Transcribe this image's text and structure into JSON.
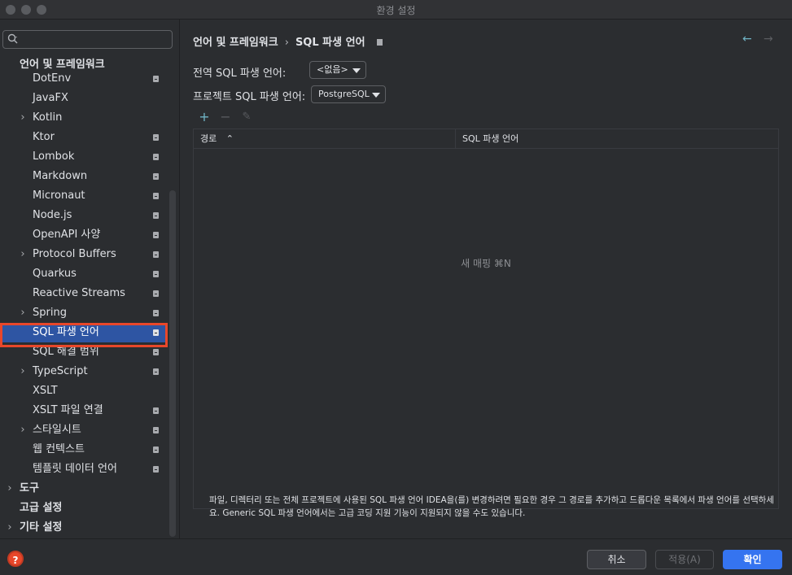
{
  "window": {
    "title": "환경 설정"
  },
  "sidebar": {
    "search_placeholder": "",
    "section_title": "언어 및 프레임워크",
    "items": [
      {
        "label": "DotEnv",
        "chevron": false,
        "mod": true
      },
      {
        "label": "JavaFX",
        "chevron": false,
        "mod": false
      },
      {
        "label": "Kotlin",
        "chevron": true,
        "mod": false
      },
      {
        "label": "Ktor",
        "chevron": false,
        "mod": true
      },
      {
        "label": "Lombok",
        "chevron": false,
        "mod": true
      },
      {
        "label": "Markdown",
        "chevron": false,
        "mod": true
      },
      {
        "label": "Micronaut",
        "chevron": false,
        "mod": true
      },
      {
        "label": "Node.js",
        "chevron": false,
        "mod": true
      },
      {
        "label": "OpenAPI 사양",
        "chevron": false,
        "mod": true
      },
      {
        "label": "Protocol Buffers",
        "chevron": true,
        "mod": true
      },
      {
        "label": "Quarkus",
        "chevron": false,
        "mod": true
      },
      {
        "label": "Reactive Streams",
        "chevron": false,
        "mod": true
      },
      {
        "label": "Spring",
        "chevron": true,
        "mod": true
      },
      {
        "label": "SQL 파생 언어",
        "chevron": false,
        "mod": true,
        "selected": true
      },
      {
        "label": "SQL 해결 범위",
        "chevron": false,
        "mod": true
      },
      {
        "label": "TypeScript",
        "chevron": true,
        "mod": true
      },
      {
        "label": "XSLT",
        "chevron": false,
        "mod": false
      },
      {
        "label": "XSLT 파일 연결",
        "chevron": false,
        "mod": true
      },
      {
        "label": "스타일시트",
        "chevron": true,
        "mod": true
      },
      {
        "label": "웹 컨텍스트",
        "chevron": false,
        "mod": true
      },
      {
        "label": "템플릿 데이터 언어",
        "chevron": false,
        "mod": true
      }
    ],
    "top_items": [
      {
        "label": "도구",
        "chevron": true
      },
      {
        "label": "고급 설정",
        "chevron": false
      },
      {
        "label": "기타 설정",
        "chevron": true
      }
    ]
  },
  "main": {
    "breadcrumb": {
      "parent": "언어 및 프레임워크",
      "separator": "›",
      "current": "SQL 파생 언어"
    },
    "nav": {
      "back": "←",
      "forward": "→"
    },
    "global_dialect_label": "전역 SQL 파생 언어:",
    "global_dialect_value": "<없음>",
    "project_dialect_label": "프로젝트 SQL 파생 언어:",
    "project_dialect_value": "PostgreSQL",
    "toolbar": {
      "add": "+",
      "remove": "−",
      "edit": "✎"
    },
    "table": {
      "col_path": "경로",
      "col_sort": "⌃",
      "col_dialect": "SQL 파생 언어",
      "empty_text": "새 매핑 ⌘N"
    },
    "description": "파일, 디렉터리 또는 전체 프로젝트에 사용된 SQL 파생 언어 IDEA을(를) 변경하려면 필요한 경우 그 경로를 추가하고 드롭다운 목록에서 파생 언어를 선택하세요. Generic SQL 파생 언어에서는 고급 코딩 지원 기능이 지원되지 않을 수도 있습니다."
  },
  "footer": {
    "help": "?",
    "cancel": "취소",
    "apply": "적용(A)",
    "ok": "확인"
  },
  "colors": {
    "accent": "#3574f0",
    "selection": "#2e55a3",
    "highlight": "#e8472a"
  }
}
